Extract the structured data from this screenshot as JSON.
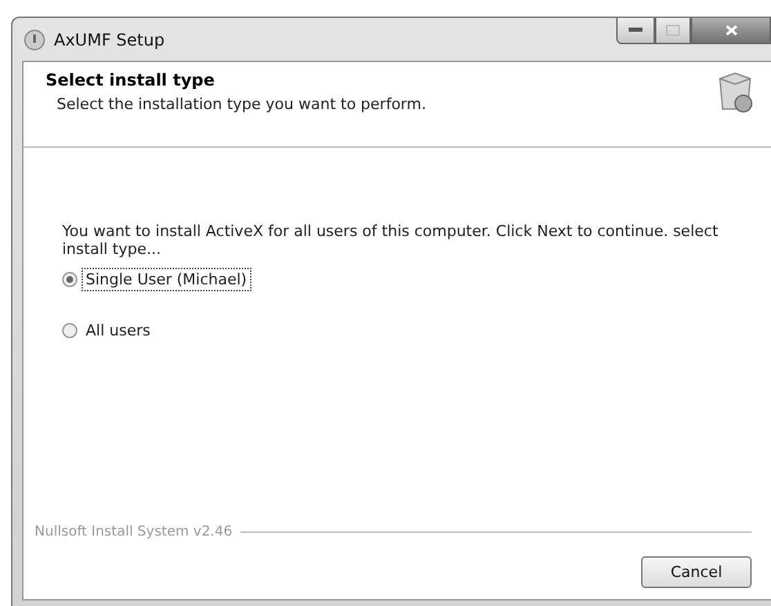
{
  "window": {
    "title": "AxUMF Setup"
  },
  "header": {
    "title": "Select install type",
    "subtitle": "Select the installation type you want to perform."
  },
  "body": {
    "message": "You want to install ActiveX for all users of this computer. Click Next to continue. select install type...",
    "options": [
      {
        "label": "Single User (Michael)",
        "selected": true
      },
      {
        "label": "All users",
        "selected": false
      }
    ]
  },
  "footer": {
    "branding": "Nullsoft Install System v2.46",
    "buttons": [
      "Cancel"
    ]
  }
}
